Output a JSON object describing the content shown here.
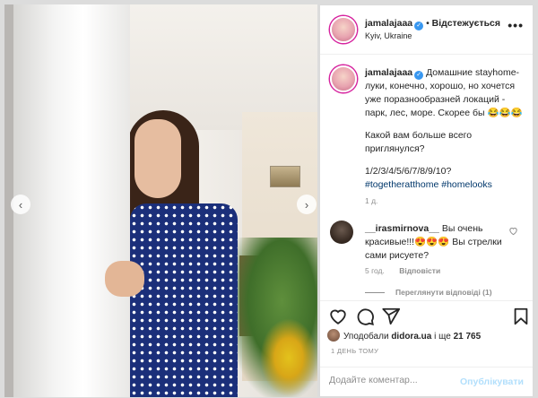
{
  "post": {
    "username": "jamalajaaa",
    "separator": "•",
    "follow_label": "Відстежується",
    "location": "Kyiv, Ukraine",
    "more_label": "•••"
  },
  "caption": {
    "username": "jamalajaaa",
    "text": "Домашние stayhome-луки, конечно, хорошо, но хочется уже поразнообразней локаций - парк, лес, море. Скорее бы 😂😂😂",
    "question": "Какой вам больше всего приглянулся?",
    "options": "1/2/3/4/5/6/7/8/9/10?",
    "hashtag1": "#togetheratthome",
    "hashtag2": "#homelooks",
    "time": "1 д."
  },
  "comment": {
    "username": "__irasmirnova__",
    "text": "Вы очень красивые!!!😍😍😍 Вы стрелки сами рисуете?",
    "time": "5 год.",
    "reply_label": "Відповісти",
    "view_replies": "Переглянути відповіді (1)"
  },
  "likes": {
    "prefix": "Уподобали",
    "user": "didora.ua",
    "middle": "і ще",
    "count": "21 765"
  },
  "date": "1 ДЕНЬ ТОМУ",
  "add_comment": {
    "placeholder": "Додайте коментар...",
    "publish_label": "Опублікувати"
  },
  "icons": {
    "prev": "chevron-left-icon",
    "next": "chevron-right-icon",
    "like": "heart-icon",
    "comment": "comment-icon",
    "share": "share-icon",
    "save": "bookmark-icon"
  },
  "colors": {
    "link": "#00376b",
    "verified": "#3897f0",
    "muted": "#8e8e8e",
    "publish_disabled": "#b2dffc"
  }
}
